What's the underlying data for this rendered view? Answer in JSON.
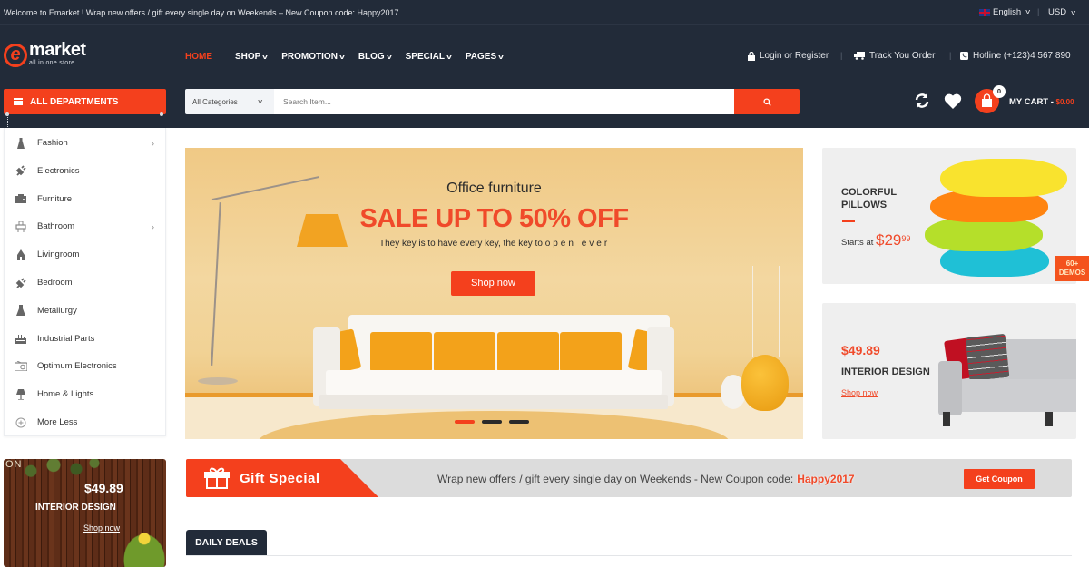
{
  "topbar": {
    "welcome": "Welcome to Emarket ! Wrap new offers / gift every single day on Weekends – New Coupon code: Happy2017",
    "language": "English",
    "currency": "USD"
  },
  "logo": {
    "name": "market",
    "letter": "e",
    "tagline": "all in one store"
  },
  "nav": {
    "items": [
      {
        "label": "HOME",
        "active": true
      },
      {
        "label": "SHOP",
        "dropdown": true
      },
      {
        "label": "PROMOTION",
        "dropdown": true
      },
      {
        "label": "BLOG",
        "dropdown": true
      },
      {
        "label": "SPECIAL",
        "dropdown": true
      },
      {
        "label": "PAGES",
        "dropdown": true
      }
    ]
  },
  "header_links": {
    "login": "Login or Register",
    "track": "Track You Order",
    "hotline": "Hotline (+123)4 567 890"
  },
  "departments": {
    "label": "ALL DEPARTMENTS"
  },
  "search": {
    "category": "All Categories",
    "placeholder": "Search Item..."
  },
  "cart": {
    "count": "0",
    "label": "MY CART - ",
    "amount": "$0.00"
  },
  "sidebar": {
    "items": [
      {
        "label": "Fashion",
        "icon": "dress-icon",
        "has_submenu": true
      },
      {
        "label": "Electronics",
        "icon": "plug-icon",
        "has_submenu": false
      },
      {
        "label": "Furniture",
        "icon": "cabinet-icon",
        "has_submenu": false
      },
      {
        "label": "Bathroom",
        "icon": "sink-icon",
        "has_submenu": true
      },
      {
        "label": "Livingroom",
        "icon": "lamp-icon",
        "has_submenu": false
      },
      {
        "label": "Bedroom",
        "icon": "plug-icon",
        "has_submenu": false
      },
      {
        "label": "Metallurgy",
        "icon": "flask-icon",
        "has_submenu": false
      },
      {
        "label": "Industrial Parts",
        "icon": "factory-icon",
        "has_submenu": false
      },
      {
        "label": "Optimum Electronics",
        "icon": "radio-icon",
        "has_submenu": false
      },
      {
        "label": "Home & Lights",
        "icon": "table-lamp-icon",
        "has_submenu": false
      },
      {
        "label": "More Less",
        "icon": "plus-circle-icon",
        "has_submenu": false
      }
    ]
  },
  "promo_left": {
    "corner_text": "ON",
    "price": "$49.89",
    "title": "INTERIOR DESIGN",
    "link": "Shop now"
  },
  "hero": {
    "kicker": "Office furniture",
    "headline": "SALE UP TO 50% OFF",
    "subtitle": "They key is to have every key, the key to",
    "subtitle_animated": "open ever",
    "button": "Shop now",
    "slides": 3,
    "active_slide": 1
  },
  "card_pillows": {
    "title_line1": "COLORFUL",
    "title_line2": "PILLOWS",
    "starts_label": "Starts at",
    "price_main": "$29",
    "price_cents": "99"
  },
  "demos_badge": {
    "line1": "60+",
    "line2": "DEMOS"
  },
  "card_interior": {
    "price": "$49.89",
    "title": "INTERIOR DESIGN",
    "link": "Shop now"
  },
  "gift_bar": {
    "label": "Gift Special",
    "message": "Wrap new offers / gift every single day on Weekends - New Coupon code:",
    "code": "Happy2017",
    "button": "Get Coupon"
  },
  "daily_deals": {
    "label": "DAILY DEALS"
  },
  "colors": {
    "accent": "#f4401d",
    "header_bg": "#222b39",
    "price_red": "#f04a2a"
  }
}
